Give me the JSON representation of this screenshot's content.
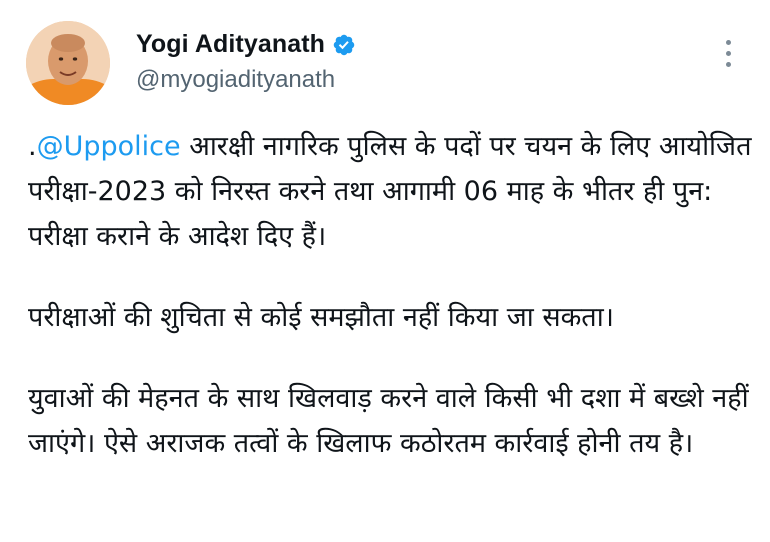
{
  "author": {
    "display_name": "Yogi Adityanath",
    "handle": "@myogiadityanath",
    "verified_icon": "verified-badge-icon",
    "verified_color": "#1d9bf0"
  },
  "menu": {
    "icon": "more-vertical-icon"
  },
  "tweet": {
    "lead_dot": ".",
    "mention": "@Uppolice",
    "para1_rest": " आरक्षी नागरिक पुलिस के पदों पर चयन के लिए आयोजित परीक्षा-2023 को निरस्त करने तथा आगामी 06 माह के भीतर ही पुन: परीक्षा कराने के आदेश दिए हैं।",
    "para2": "परीक्षाओं की शुचिता से कोई समझौता नहीं किया जा सकता।",
    "para3": "युवाओं की मेहनत के साथ खिलवाड़ करने वाले किसी भी दशा में बख्शे नहीं जाएंगे। ऐसे अराजक तत्वों के खिलाफ कठोरतम कार्रवाई होनी तय है।"
  },
  "colors": {
    "text": "#0f1419",
    "secondary": "#536471",
    "link": "#1d9bf0"
  }
}
